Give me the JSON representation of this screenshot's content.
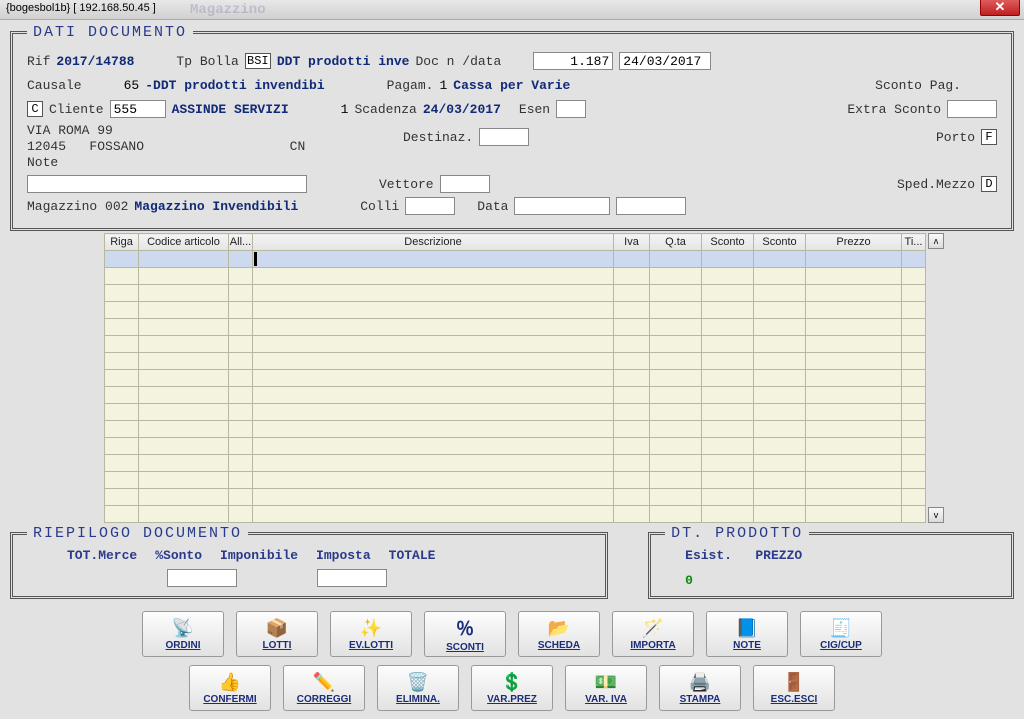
{
  "window_title": "{bogesbol1b} [ 192.168.50.45 ]",
  "faded_tab": "Magazzino",
  "panel_dati": {
    "legend": "DATI DOCUMENTO",
    "rif_lbl": "Rif",
    "rif_val": "2017/14788",
    "tpbolla_lbl": "Tp Bolla",
    "tpbolla_code": "BSI",
    "tpbolla_desc": "DDT prodotti inve",
    "docn_lbl": "Doc n /data",
    "docn_val": "1.187",
    "doc_date": "24/03/2017",
    "causale_lbl": "Causale",
    "causale_code": "65",
    "causale_desc": "-DDT prodotti invendibi",
    "pagam_lbl": "Pagam.",
    "pagam_code": "1",
    "pagam_desc": "Cassa per Varie",
    "sconto_pag": "Sconto Pag.",
    "tipo_code": "C",
    "tipo_lbl": "Cliente",
    "cliente_code": "555",
    "cliente_nome": "ASSINDE SERVIZI",
    "scad_n": "1",
    "scad_lbl": "Scadenza",
    "scad_val": "24/03/2017",
    "esen_lbl": "Esen",
    "extra_sconto": "Extra Sconto",
    "addr1": "VIA ROMA 99",
    "addr2a": "12045",
    "addr2b": "FOSSANO",
    "addr2c": "CN",
    "destinaz_lbl": "Destinaz.",
    "porto_lbl": "Porto",
    "porto_val": "F",
    "note_lbl": "Note",
    "vettore_lbl": "Vettore",
    "sped_lbl": "Sped.Mezzo",
    "sped_val": "D",
    "mag_lbl": "Magazzino 002",
    "mag_desc": "Magazzino Invendibili",
    "colli_lbl": "Colli",
    "data_lbl": "Data"
  },
  "grid": {
    "headers": [
      "Riga",
      "Codice articolo",
      "All...",
      "Descrizione",
      "Iva",
      "Q.ta",
      "Sconto",
      "Sconto",
      "Prezzo",
      "Ti..."
    ]
  },
  "riepilogo": {
    "legend": "RIEPILOGO DOCUMENTO",
    "c1": "TOT.Merce",
    "c2": "%Sonto",
    "c3": "Imponibile",
    "c4": "Imposta",
    "c5": "TOTALE"
  },
  "dtprod": {
    "legend": "DT. PRODOTTO",
    "c1": "Esist.",
    "c2": "PREZZO",
    "zero": "0"
  },
  "buttons_row1": [
    {
      "icon": "📡",
      "label": "ORDINI",
      "name": "ordini-button"
    },
    {
      "icon": "📦",
      "label": "LOTTI",
      "name": "lotti-button"
    },
    {
      "icon": "✨",
      "label": "EV.LOTTI",
      "name": "evlotti-button"
    },
    {
      "icon": "％",
      "label": "SCONTI",
      "name": "sconti-button"
    },
    {
      "icon": "📂",
      "label": "SCHEDA",
      "name": "scheda-button"
    },
    {
      "icon": "🪄",
      "label": "IMPORTA",
      "name": "importa-button"
    },
    {
      "icon": "📘",
      "label": "NOTE",
      "name": "note-button"
    },
    {
      "icon": "🧾",
      "label": "CIG/CUP",
      "name": "cigcup-button"
    }
  ],
  "buttons_row2": [
    {
      "icon": "👍",
      "label": "CONFERMI",
      "name": "confermi-button"
    },
    {
      "icon": "✏️",
      "label": "CORREGGI",
      "name": "correggi-button"
    },
    {
      "icon": "🗑️",
      "label": "ELIMINA.",
      "name": "elimina-button"
    },
    {
      "icon": "💲",
      "label": "VAR.PREZ",
      "name": "varprez-button"
    },
    {
      "icon": "💵",
      "label": "VAR. IVA",
      "name": "variva-button"
    },
    {
      "icon": "🖨️",
      "label": "STAMPA",
      "name": "stampa-button"
    },
    {
      "icon": "🚪",
      "label": "ESC.ESCI",
      "name": "esci-button"
    }
  ]
}
